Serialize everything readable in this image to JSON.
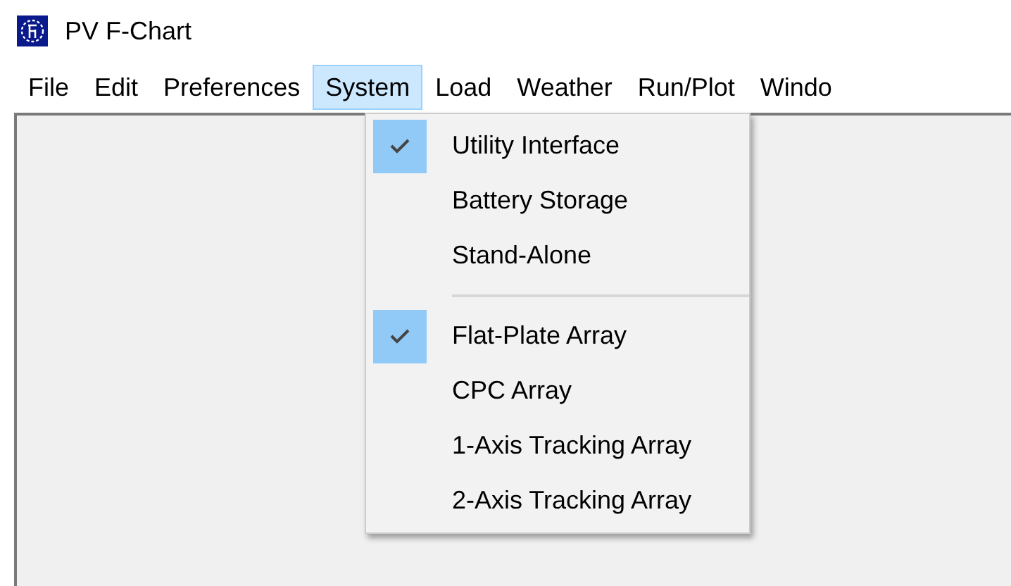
{
  "window": {
    "title": "PV F-Chart"
  },
  "menu_bar": [
    {
      "label": "File",
      "selected": false
    },
    {
      "label": "Edit",
      "selected": false
    },
    {
      "label": "Preferences",
      "selected": false
    },
    {
      "label": "System",
      "selected": true
    },
    {
      "label": "Load",
      "selected": false
    },
    {
      "label": "Weather",
      "selected": false
    },
    {
      "label": "Run/Plot",
      "selected": false
    },
    {
      "label": "Windo",
      "selected": false
    }
  ],
  "system_menu": [
    {
      "kind": "item",
      "label": "Utility Interface",
      "checked": true
    },
    {
      "kind": "item",
      "label": "Battery Storage",
      "checked": false
    },
    {
      "kind": "item",
      "label": "Stand-Alone",
      "checked": false
    },
    {
      "kind": "separator"
    },
    {
      "kind": "item",
      "label": "Flat-Plate Array",
      "checked": true
    },
    {
      "kind": "item",
      "label": "CPC Array",
      "checked": false
    },
    {
      "kind": "item",
      "label": "1-Axis Tracking Array",
      "checked": false
    },
    {
      "kind": "item",
      "label": "2-Axis Tracking Array",
      "checked": false
    }
  ]
}
